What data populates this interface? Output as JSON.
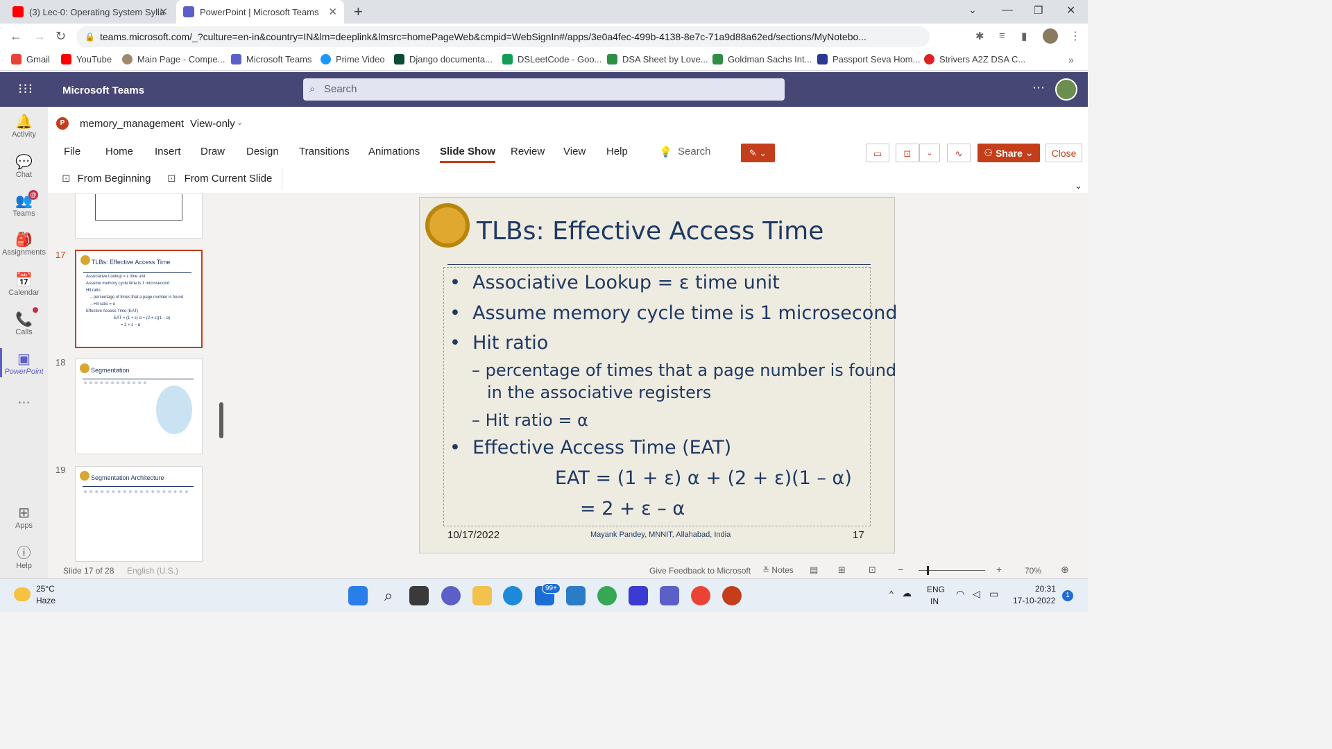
{
  "browser": {
    "tabs": [
      {
        "label": "(3) Lec-0: Operating System Sylla"
      },
      {
        "label": "PowerPoint | Microsoft Teams"
      }
    ],
    "url": "teams.microsoft.com/_?culture=en-in&country=IN&lm=deeplink&lmsrc=homePageWeb&cmpid=WebSignIn#/apps/3e0a4fec-499b-4138-8e7c-71a9d88a62ed/sections/MyNotebo...",
    "bookmarks": [
      "Gmail",
      "YouTube",
      "Main Page - Compe...",
      "Microsoft Teams",
      "Prime Video",
      "Django documenta...",
      "DSLeetCode - Goo...",
      "DSA Sheet by Love...",
      "Goldman Sachs Int...",
      "Passport Seva Hom...",
      "Strivers A2Z DSA C..."
    ]
  },
  "teams": {
    "app_name": "Microsoft Teams",
    "search_placeholder": "Search",
    "rail": [
      {
        "label": "Activity"
      },
      {
        "label": "Chat"
      },
      {
        "label": "Teams"
      },
      {
        "label": "Assignments"
      },
      {
        "label": "Calendar"
      },
      {
        "label": "Calls"
      },
      {
        "label": "PowerPoint"
      },
      {
        "label": "Apps"
      },
      {
        "label": "Help"
      }
    ]
  },
  "ppt": {
    "filename": "memory_management",
    "mode": "View-only",
    "menus": [
      "File",
      "Home",
      "Insert",
      "Draw",
      "Design",
      "Transitions",
      "Animations",
      "Slide Show",
      "Review",
      "View",
      "Help"
    ],
    "active_menu": "Slide Show",
    "search": "Search",
    "share": "Share",
    "close": "Close",
    "ribbon": [
      "From Beginning",
      "From Current Slide"
    ]
  },
  "thumbnails": [
    {
      "num": "17",
      "title": "TLBs: Effective Access Time"
    },
    {
      "num": "18",
      "title": "Segmentation"
    },
    {
      "num": "19",
      "title": "Segmentation Architecture"
    }
  ],
  "slide": {
    "title": "TLBs: Effective Access Time",
    "b1": "Associative Lookup = ε time unit",
    "b2": "Assume memory cycle time is 1 microsecond",
    "b3": "Hit ratio",
    "s1": "– percentage of times that a page number is found",
    "s1b": "in the associative registers",
    "s2": "– Hit ratio = α",
    "b4": "Effective Access Time (EAT)",
    "eq1": "EAT = (1 + ε) α + (2 + ε)(1 – α)",
    "eq2": "= 2 + ε – α",
    "date": "10/17/2022",
    "author": "Mayank Pandey, MNNIT, Allahabad, India",
    "num": "17"
  },
  "status": {
    "slide": "Slide 17 of 28",
    "lang": "English (U.S.)",
    "feedback": "Give Feedback to Microsoft",
    "notes": "Notes",
    "zoom": "70%"
  },
  "taskbar": {
    "temp": "25°C",
    "weather": "Haze",
    "lang1": "ENG",
    "lang2": "IN",
    "time": "20:31",
    "date": "17-10-2022",
    "mail_badge": "99+",
    "notif": "1"
  }
}
